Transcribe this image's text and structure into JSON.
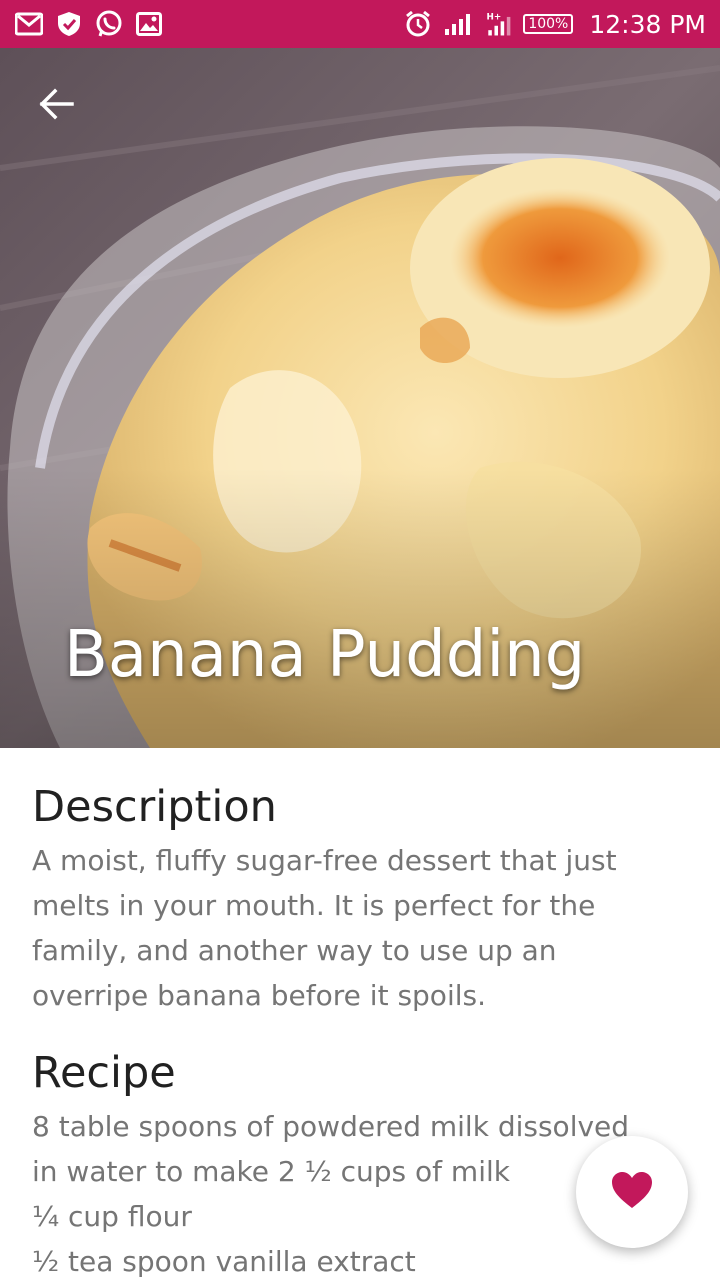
{
  "status_bar": {
    "time": "12:38 PM",
    "battery": "100%",
    "left_icons": [
      "gmail-icon",
      "shield-icon",
      "whatsapp-icon",
      "image-icon"
    ],
    "right_icons": [
      "alarm-icon",
      "signal-icon",
      "data-signal-icon",
      "battery-icon"
    ]
  },
  "hero": {
    "title": "Banana Pudding",
    "back_icon": "arrow-left-icon"
  },
  "description": {
    "heading": "Description",
    "text": "A moist, fluffy sugar-free dessert that just melts in your mouth.  It is perfect for the family, and another way to use up an overripe banana before it spoils."
  },
  "recipe": {
    "heading": "Recipe",
    "lines": [
      "8 table spoons of powdered milk dissolved",
      "in water to make 2 ½ cups of milk",
      "¼  cup flour",
      "½ tea spoon vanilla extract"
    ]
  },
  "fab": {
    "icon": "heart-icon",
    "color": "#c2185b"
  },
  "colors": {
    "accent": "#c2185b",
    "heading": "#212121",
    "body": "#757575"
  }
}
